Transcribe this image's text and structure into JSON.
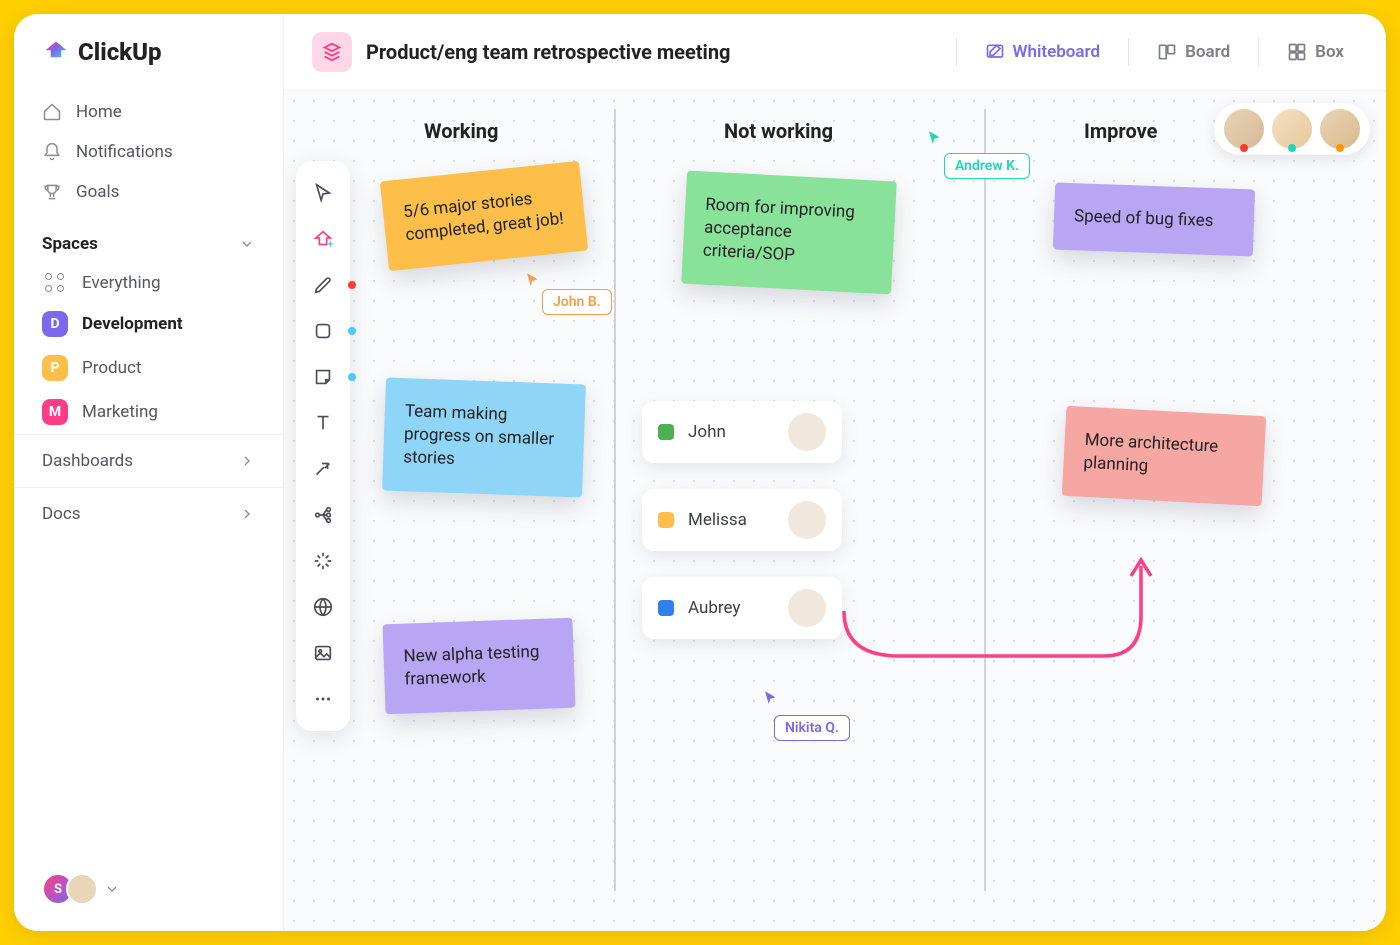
{
  "brand": "ClickUp",
  "sidebar": {
    "nav": [
      {
        "label": "Home",
        "icon": "home"
      },
      {
        "label": "Notifications",
        "icon": "bell"
      },
      {
        "label": "Goals",
        "icon": "trophy"
      }
    ],
    "spaces_header": "Spaces",
    "everything_label": "Everything",
    "spaces": [
      {
        "letter": "D",
        "label": "Development",
        "color": "#7B68EE",
        "active": true
      },
      {
        "letter": "P",
        "label": "Product",
        "color": "#FDBE4A",
        "active": false
      },
      {
        "letter": "M",
        "label": "Marketing",
        "color": "#FF3C86",
        "active": false
      }
    ],
    "collapsibles": [
      {
        "label": "Dashboards"
      },
      {
        "label": "Docs"
      }
    ]
  },
  "header": {
    "title": "Product/eng team retrospective meeting",
    "views": [
      {
        "label": "Whiteboard",
        "icon": "whiteboard",
        "active": true
      },
      {
        "label": "Board",
        "icon": "board",
        "active": false
      },
      {
        "label": "Box",
        "icon": "box",
        "active": false
      }
    ]
  },
  "columns": [
    {
      "label": "Working"
    },
    {
      "label": "Not working"
    },
    {
      "label": "Improve"
    }
  ],
  "stickies": {
    "s1": "5/6 major stories completed, great job!",
    "s2": "Team making progress on smaller stories",
    "s3": "New alpha testing framework",
    "s4": "Room for improving acceptance criteria/SOP",
    "s5": "Speed of bug fixes",
    "s6": "More architecture planning"
  },
  "cursors": {
    "john": "John B.",
    "andrew": "Andrew K.",
    "nikita": "Nikita Q."
  },
  "users": [
    {
      "name": "John",
      "color": "#4CAF50"
    },
    {
      "name": "Melissa",
      "color": "#FDBE4A"
    },
    {
      "name": "Aubrey",
      "color": "#2F80ED"
    }
  ],
  "presence_colors": [
    "#FF3B30",
    "#1AD9B3",
    "#FF9500"
  ]
}
